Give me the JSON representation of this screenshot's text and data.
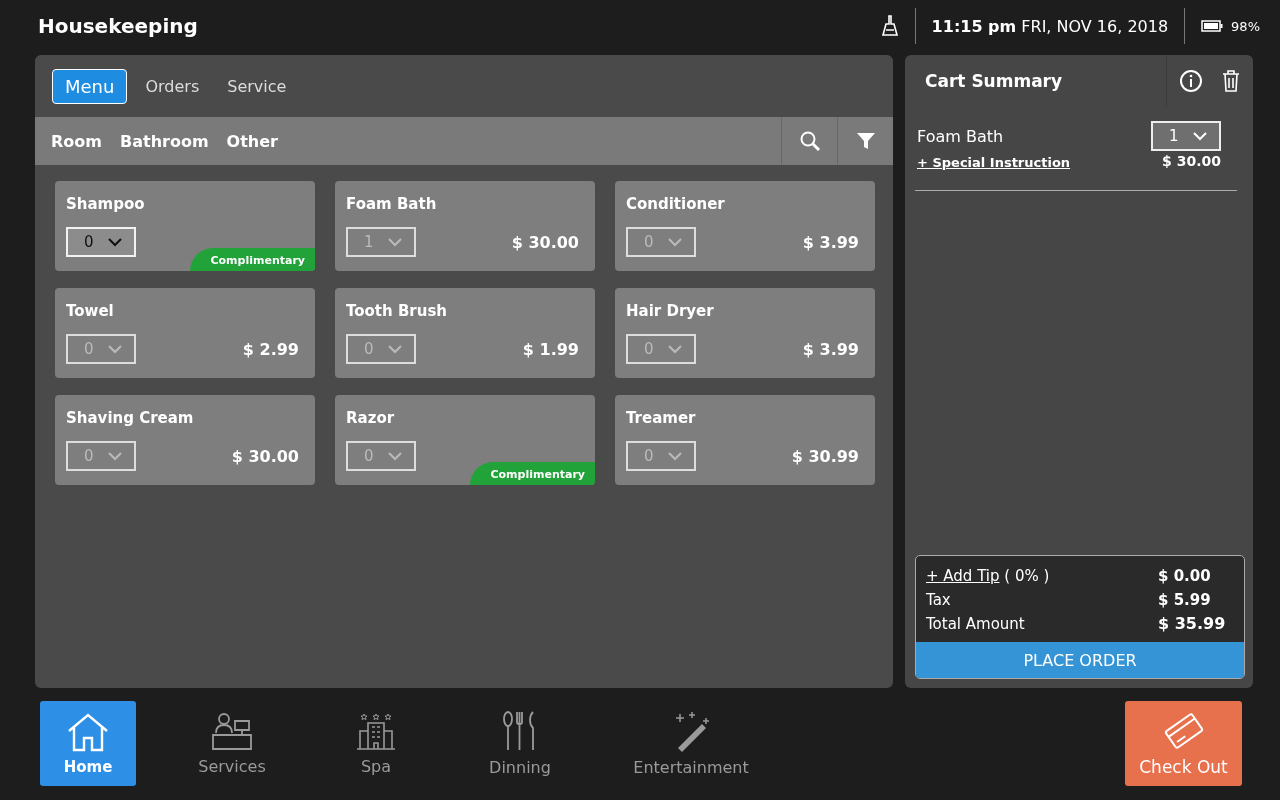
{
  "header": {
    "title": "Housekeeping",
    "time": "11:15 pm",
    "date": "FRI, NOV 16, 2018",
    "battery": "98%"
  },
  "tabs": [
    {
      "label": "Menu",
      "selected": true
    },
    {
      "label": "Orders",
      "selected": false
    },
    {
      "label": "Service",
      "selected": false
    }
  ],
  "categories": [
    {
      "label": "Room"
    },
    {
      "label": "Bathroom"
    },
    {
      "label": "Other"
    }
  ],
  "products": [
    {
      "name": "Shampoo",
      "quantity": "0",
      "disabled": false,
      "badge": "Complimentary"
    },
    {
      "name": "Foam Bath",
      "quantity": "1",
      "disabled": true,
      "price": "$ 30.00"
    },
    {
      "name": "Conditioner",
      "quantity": "0",
      "disabled": true,
      "price": "$ 3.99"
    },
    {
      "name": "Towel",
      "quantity": "0",
      "disabled": true,
      "price": "$ 2.99"
    },
    {
      "name": "Tooth Brush",
      "quantity": "0",
      "disabled": true,
      "price": "$ 1.99"
    },
    {
      "name": "Hair Dryer",
      "quantity": "0",
      "disabled": true,
      "price": "$ 3.99"
    },
    {
      "name": "Shaving Cream",
      "quantity": "0",
      "disabled": true,
      "price": "$ 30.00"
    },
    {
      "name": "Razor",
      "quantity": "0",
      "disabled": true,
      "badge": "Complimentary"
    },
    {
      "name": "Treamer",
      "quantity": "0",
      "disabled": true,
      "price": "$ 30.99"
    }
  ],
  "cart": {
    "title": "Cart Summary",
    "items": [
      {
        "name": "Foam Bath",
        "quantity": "1",
        "link": "+ Special Instruction",
        "price": "$ 30.00"
      }
    ],
    "tip_link": "+ Add Tip",
    "tip_percent": "( 0% )",
    "tip": "$ 0.00",
    "tax_label": "Tax",
    "tax": "$ 5.99",
    "total_label": "Total Amount",
    "total": "$ 35.99",
    "button": "PLACE ORDER"
  },
  "nav": [
    {
      "kind": "home",
      "label": "Home",
      "selected": true
    },
    {
      "kind": "services",
      "label": "Services",
      "selected": false
    },
    {
      "kind": "spa",
      "label": "Spa",
      "selected": false
    },
    {
      "kind": "dining",
      "label": "Dinning",
      "selected": false
    },
    {
      "kind": "entertainment",
      "label": "Entertainment",
      "selected": false
    }
  ],
  "checkout": {
    "label": "Check Out"
  }
}
